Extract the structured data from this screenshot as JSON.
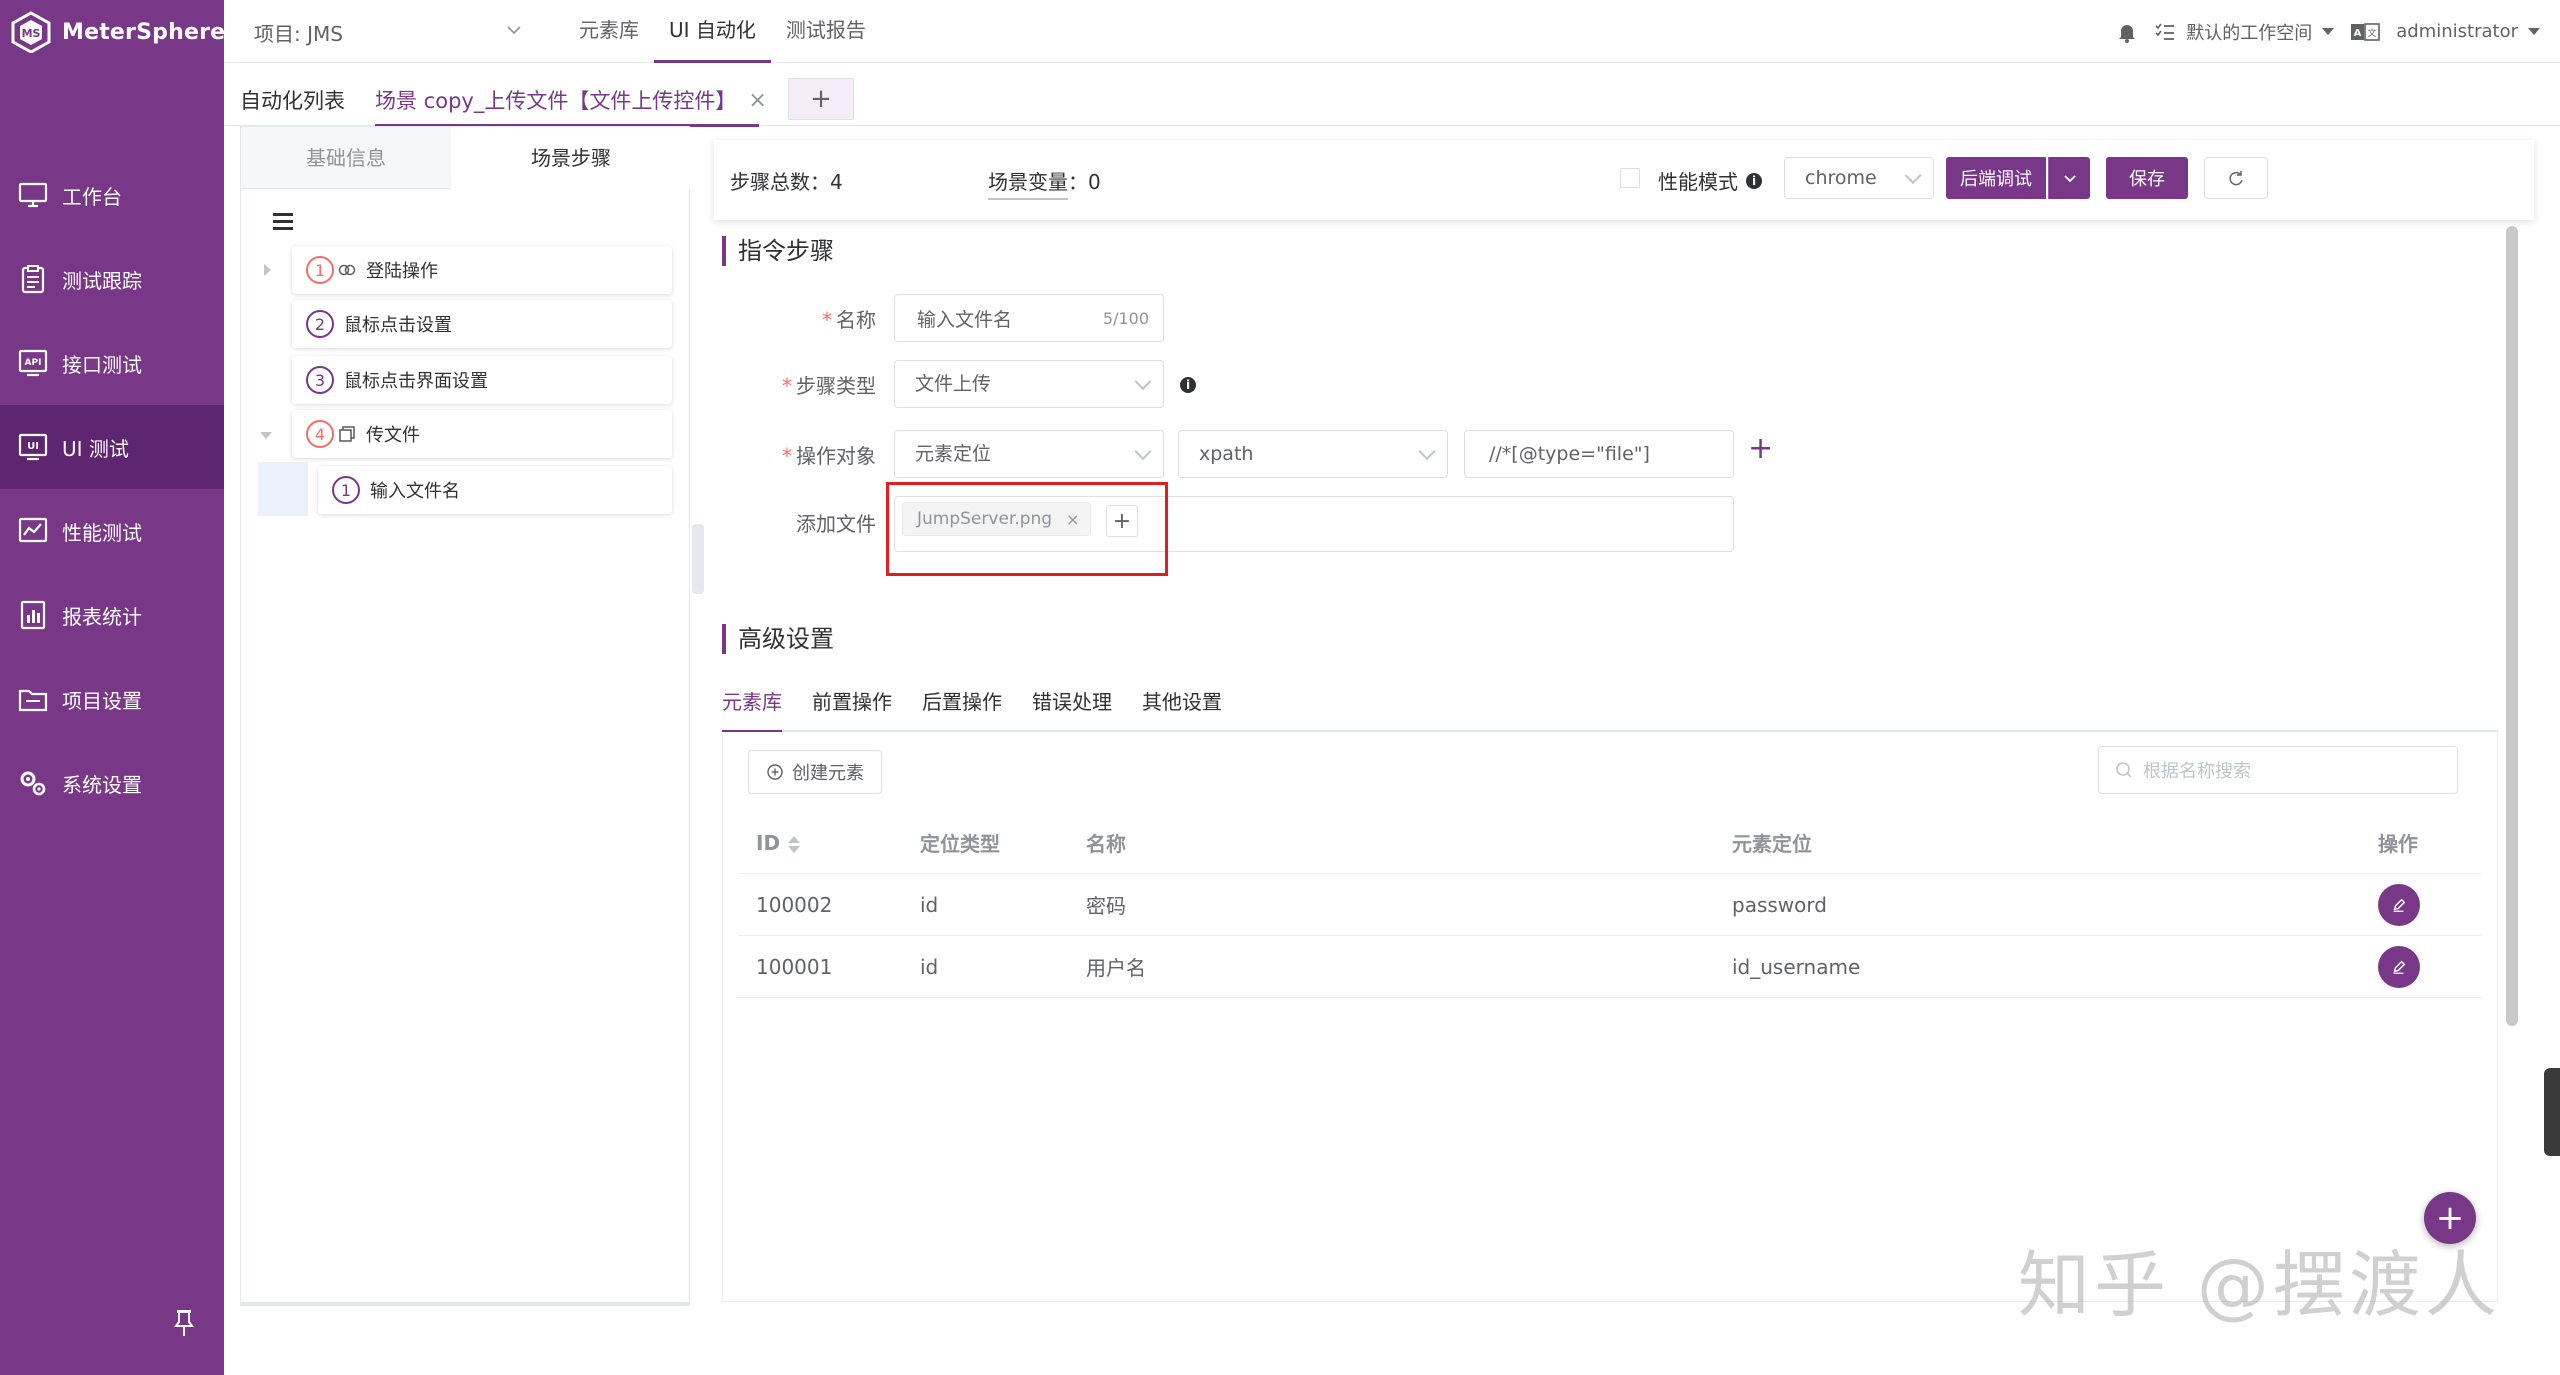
{
  "app": {
    "brand": "MeterSphere",
    "colors": {
      "primary": "#783887",
      "sidebar": "#783887",
      "sidebar_active": "#5e2670",
      "highlight": "#e02020"
    }
  },
  "sidebar": {
    "items": [
      {
        "label": "工作台",
        "icon": "monitor-icon"
      },
      {
        "label": "测试跟踪",
        "icon": "clipboard-icon"
      },
      {
        "label": "接口测试",
        "icon": "api-icon"
      },
      {
        "label": "UI 测试",
        "icon": "ui-icon",
        "active": true
      },
      {
        "label": "性能测试",
        "icon": "chart-icon"
      },
      {
        "label": "报表统计",
        "icon": "report-icon"
      },
      {
        "label": "项目设置",
        "icon": "folder-icon"
      },
      {
        "label": "系统设置",
        "icon": "gear-icon"
      }
    ]
  },
  "topbar": {
    "project": "项目: JMS",
    "menu": [
      "元素库",
      "UI 自动化",
      "测试报告"
    ],
    "workspace": "默认的工作空间",
    "lang_icon": "translate-icon",
    "user": "administrator"
  },
  "tabs": {
    "list": "自动化列表",
    "active": "场景 copy_上传文件【文件上传控件】",
    "close": "×",
    "add": "+"
  },
  "left": {
    "tab_basic": "基础信息",
    "tab_steps": "场景步骤",
    "tree": [
      {
        "num": "1",
        "label": "登陆操作"
      },
      {
        "num": "2",
        "label": "鼠标点击设置"
      },
      {
        "num": "3",
        "label": "鼠标点击界面设置"
      },
      {
        "num": "4",
        "label": "传文件"
      },
      {
        "num": "1",
        "label": "输入文件名"
      }
    ]
  },
  "toolbar": {
    "steps_total": "步骤总数：4",
    "scene_vars": "场景变量",
    "scene_vars_count": "：0",
    "perf_mode": "性能模式",
    "browser": "chrome",
    "debug": "后端调试",
    "save": "保存"
  },
  "step": {
    "section": "指令步骤",
    "name_label": "名称",
    "name_value": "输入文件名",
    "name_counter": "5/100",
    "type_label": "步骤类型",
    "type_value": "文件上传",
    "target_label": "操作对象",
    "target_value": "元素定位",
    "locator_type": "xpath",
    "locator_value": "//*[@type=\"file\"]",
    "file_label": "添加文件",
    "file_name": "JumpServer.png"
  },
  "advanced": {
    "section": "高级设置",
    "tabs": [
      "元素库",
      "前置操作",
      "后置操作",
      "错误处理",
      "其他设置"
    ],
    "create_button": "创建元素",
    "search_placeholder": "根据名称搜索",
    "columns": [
      "ID",
      "定位类型",
      "名称",
      "元素定位",
      "操作"
    ],
    "rows": [
      {
        "id": "100002",
        "type": "id",
        "name": "密码",
        "locator": "password"
      },
      {
        "id": "100001",
        "type": "id",
        "name": "用户名",
        "locator": "id_username"
      }
    ]
  },
  "watermark": "知乎 @摆渡人"
}
